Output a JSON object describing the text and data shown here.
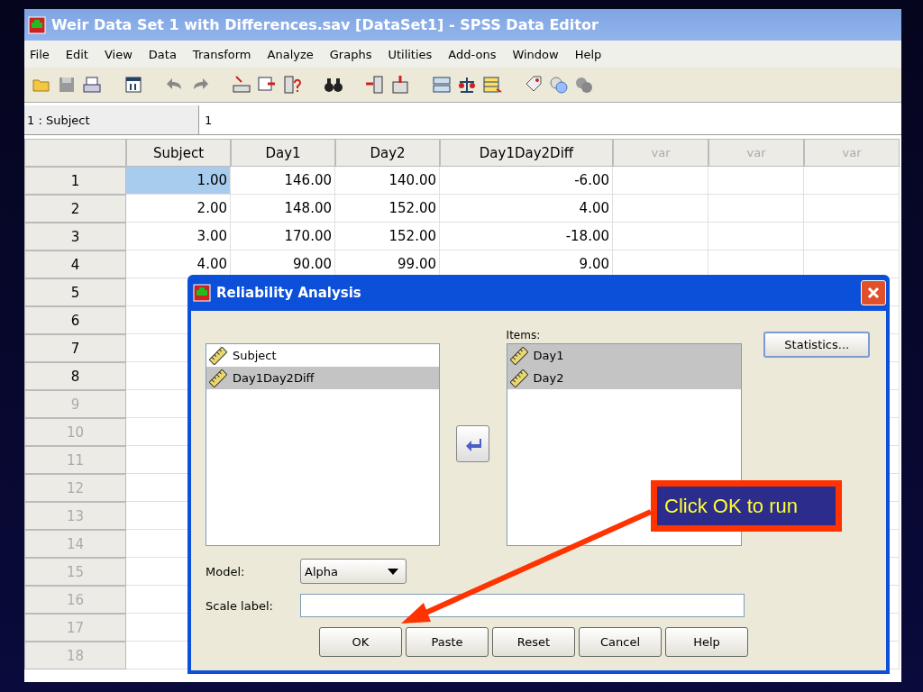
{
  "window": {
    "title": "Weir Data Set 1 with Differences.sav [DataSet1] - SPSS Data Editor"
  },
  "menu": [
    "File",
    "Edit",
    "View",
    "Data",
    "Transform",
    "Analyze",
    "Graphs",
    "Utilities",
    "Add-ons",
    "Window",
    "Help"
  ],
  "cell_ref": {
    "name": "1 : Subject",
    "value": "1"
  },
  "grid": {
    "columns": [
      {
        "label": "Subject",
        "defined": true
      },
      {
        "label": "Day1",
        "defined": true
      },
      {
        "label": "Day2",
        "defined": true
      },
      {
        "label": "Day1Day2Diff",
        "defined": true
      },
      {
        "label": "var",
        "defined": false
      },
      {
        "label": "var",
        "defined": false
      },
      {
        "label": "var",
        "defined": false
      }
    ],
    "rows": [
      {
        "number": "1",
        "dimmed": false,
        "cells": [
          {
            "text": "1.00",
            "selected": true
          },
          {
            "text": "146.00",
            "selected": false
          },
          {
            "text": "140.00",
            "selected": false
          },
          {
            "text": "-6.00",
            "selected": false
          }
        ]
      },
      {
        "number": "2",
        "dimmed": false,
        "cells": [
          {
            "text": "2.00",
            "selected": false
          },
          {
            "text": "148.00",
            "selected": false
          },
          {
            "text": "152.00",
            "selected": false
          },
          {
            "text": "4.00",
            "selected": false
          }
        ]
      },
      {
        "number": "3",
        "dimmed": false,
        "cells": [
          {
            "text": "3.00",
            "selected": false
          },
          {
            "text": "170.00",
            "selected": false
          },
          {
            "text": "152.00",
            "selected": false
          },
          {
            "text": "-18.00",
            "selected": false
          }
        ]
      },
      {
        "number": "4",
        "dimmed": false,
        "cells": [
          {
            "text": "4.00",
            "selected": false
          },
          {
            "text": "90.00",
            "selected": false
          },
          {
            "text": "99.00",
            "selected": false
          },
          {
            "text": "9.00",
            "selected": false
          }
        ]
      },
      {
        "number": "5",
        "dimmed": false
      },
      {
        "number": "6",
        "dimmed": false
      },
      {
        "number": "7",
        "dimmed": false
      },
      {
        "number": "8",
        "dimmed": false
      },
      {
        "number": "9",
        "dimmed": true
      },
      {
        "number": "10",
        "dimmed": true
      },
      {
        "number": "11",
        "dimmed": true
      },
      {
        "number": "12",
        "dimmed": true
      },
      {
        "number": "13",
        "dimmed": true
      },
      {
        "number": "14",
        "dimmed": true
      },
      {
        "number": "15",
        "dimmed": true
      },
      {
        "number": "16",
        "dimmed": true
      },
      {
        "number": "17",
        "dimmed": true
      },
      {
        "number": "18",
        "dimmed": true
      }
    ]
  },
  "dialog": {
    "title": "Reliability Analysis",
    "source_list": [
      {
        "label": "Subject",
        "selected": false
      },
      {
        "label": "Day1Day2Diff",
        "selected": true
      }
    ],
    "items_label": "Items:",
    "items": [
      {
        "label": "Day1",
        "selected": true
      },
      {
        "label": "Day2",
        "selected": true
      }
    ],
    "statistics_button": "Statistics...",
    "model_label": "Model:",
    "model": "Alpha",
    "scale_label": "Scale label:",
    "buttons": [
      "OK",
      "Paste",
      "Reset",
      "Cancel",
      "Help"
    ]
  },
  "callout": {
    "text": "Click OK to run"
  }
}
